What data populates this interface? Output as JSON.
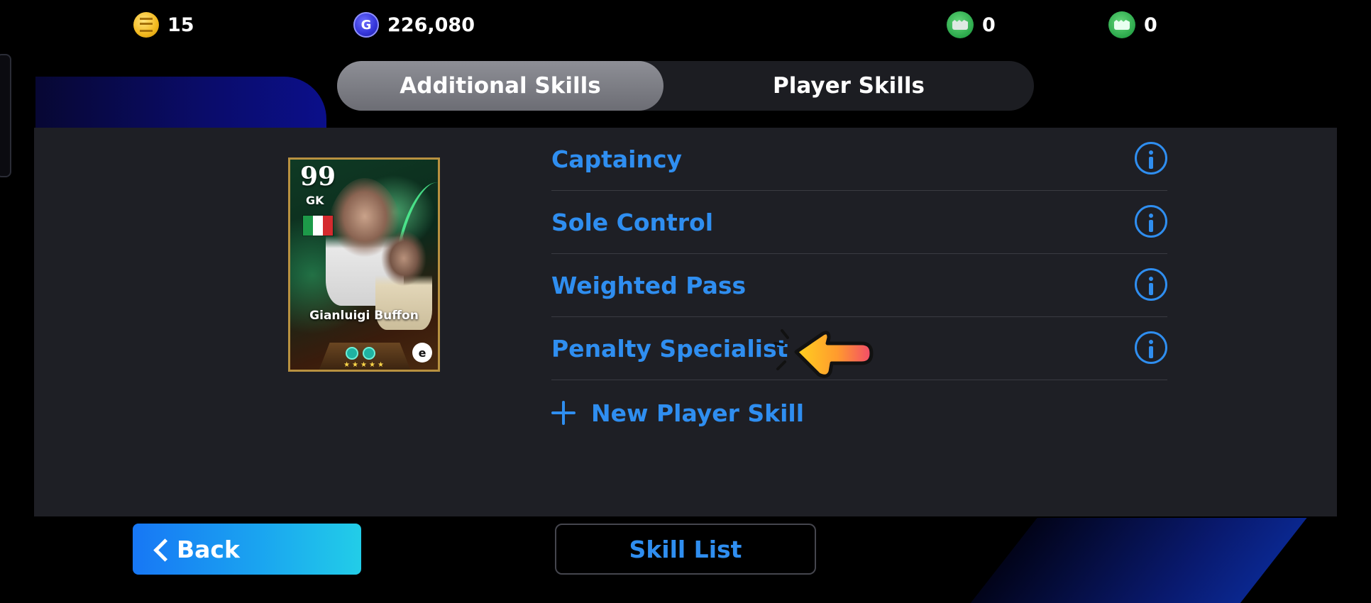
{
  "currency": {
    "coins": "15",
    "gp": "226,080",
    "ticket_a": "0",
    "ticket_b": "0"
  },
  "tabs": {
    "additional_skills": "Additional Skills",
    "player_skills": "Player Skills",
    "active": "Additional Skills"
  },
  "player_card": {
    "rating": "99",
    "position": "GK",
    "name": "Gianluigi Buffon",
    "nationality_flag_colors": [
      "#1d9a49",
      "#ffffff",
      "#d52b2f"
    ],
    "stars": "★★★★★"
  },
  "skills": [
    {
      "label": "Captaincy"
    },
    {
      "label": "Sole Control"
    },
    {
      "label": "Weighted Pass"
    },
    {
      "label": "Penalty Specialist"
    }
  ],
  "new_skill_label": "New Player Skill",
  "buttons": {
    "back": "Back",
    "skill_list": "Skill List"
  },
  "colors": {
    "accent_blue": "#2f8ef0",
    "panel_bg": "#1e1f25",
    "active_tab": "#7d7e85"
  },
  "icons": {
    "coin": "coin-icon",
    "gp": "gp-icon",
    "ticket": "ticket-icon",
    "info": "info-icon",
    "plus": "plus-icon",
    "back": "chevron-left-icon",
    "pointer": "pointing-hand-icon"
  }
}
